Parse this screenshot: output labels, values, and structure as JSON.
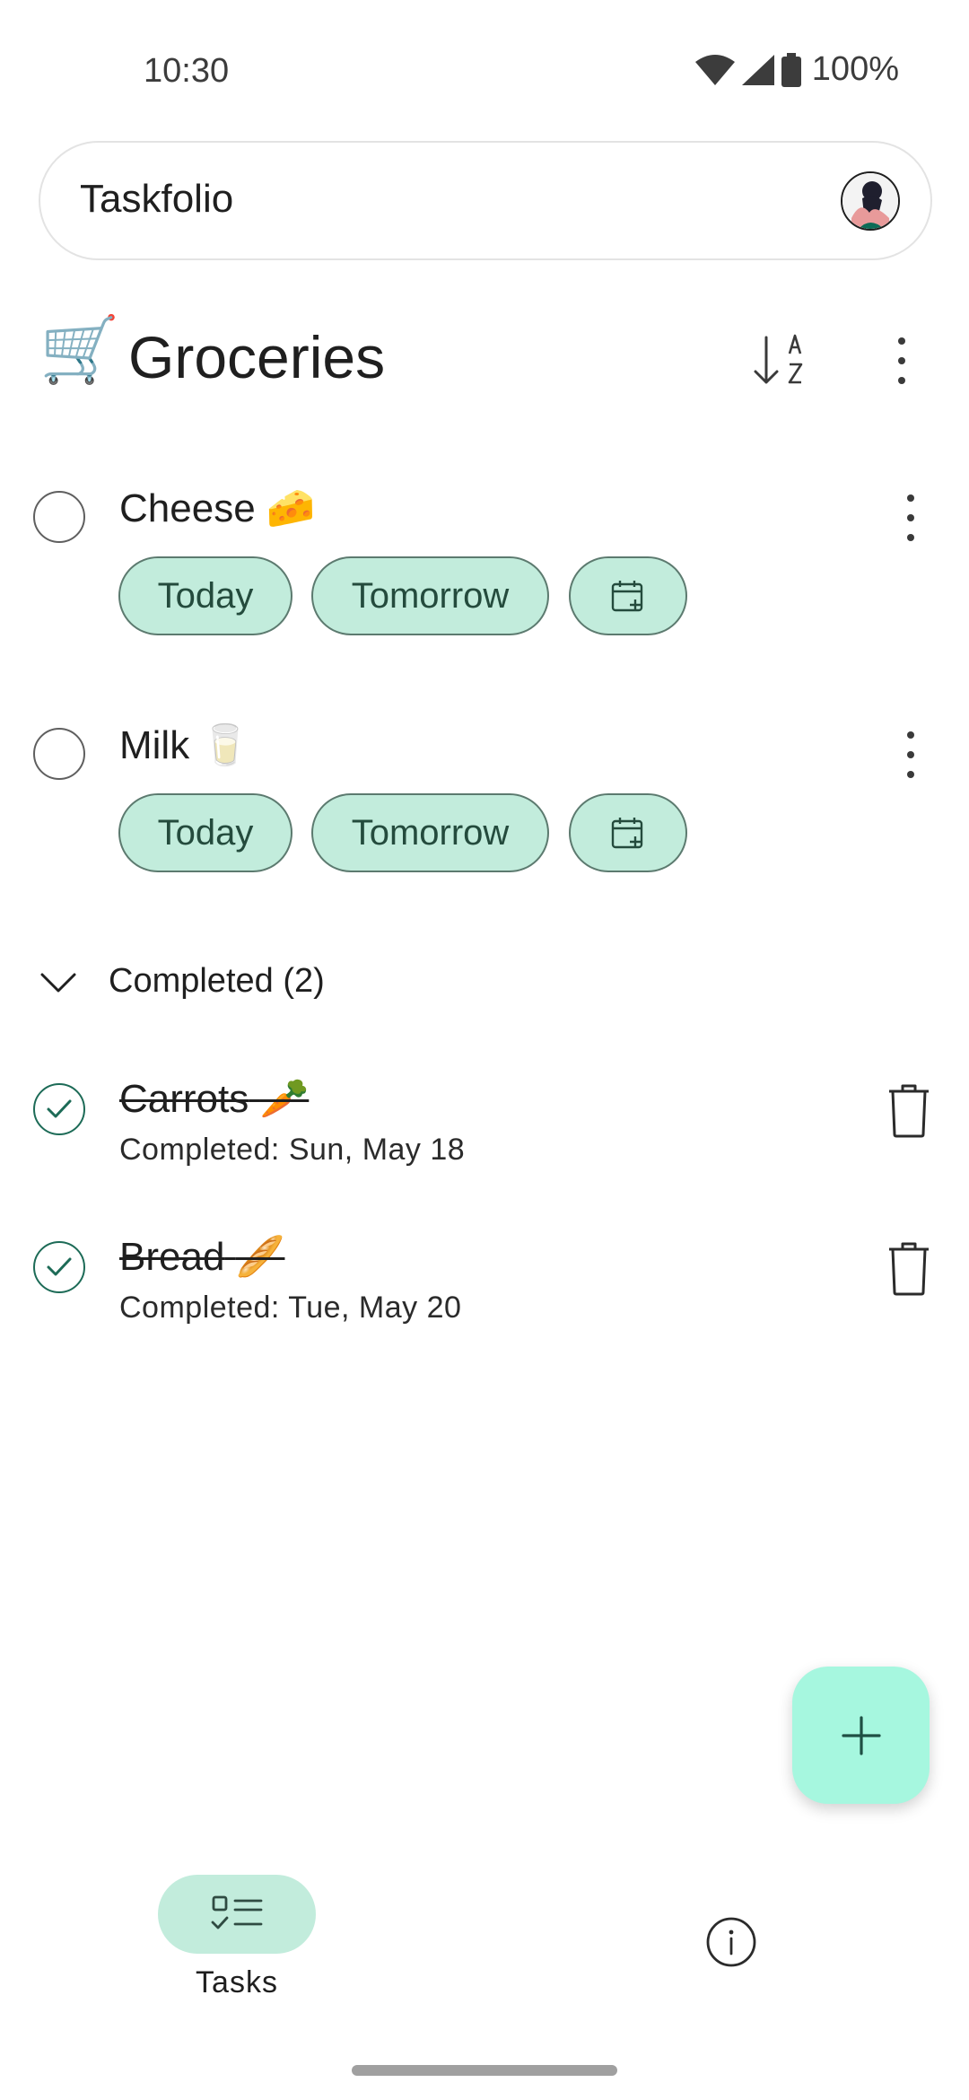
{
  "status_bar": {
    "time": "10:30",
    "battery": "100%"
  },
  "app": {
    "title": "Taskfolio"
  },
  "list": {
    "emoji": "🛒",
    "title": "Groceries"
  },
  "tasks": [
    {
      "title": "Cheese",
      "emoji": "🧀",
      "chips": [
        "Today",
        "Tomorrow"
      ]
    },
    {
      "title": "Milk",
      "emoji": "🥛",
      "chips": [
        "Today",
        "Tomorrow"
      ]
    }
  ],
  "completed": {
    "label": "Completed (2)",
    "items": [
      {
        "title": "Carrots",
        "emoji": "🥕",
        "completed_text": "Completed: Sun, May 18"
      },
      {
        "title": "Bread",
        "emoji": "🥖",
        "completed_text": "Completed: Tue, May 20"
      }
    ]
  },
  "nav": {
    "tasks_label": "Tasks"
  },
  "icons": {
    "sort": "sort-az-icon",
    "more": "more-vert-icon",
    "calendar": "calendar-add-icon",
    "delete": "trash-icon",
    "add": "plus-icon",
    "tasks": "checklist-icon",
    "info": "info-icon"
  },
  "colors": {
    "chip_bg": "#c2ecdc",
    "accent": "#1d6b57",
    "fab_bg": "#a6f7df"
  }
}
